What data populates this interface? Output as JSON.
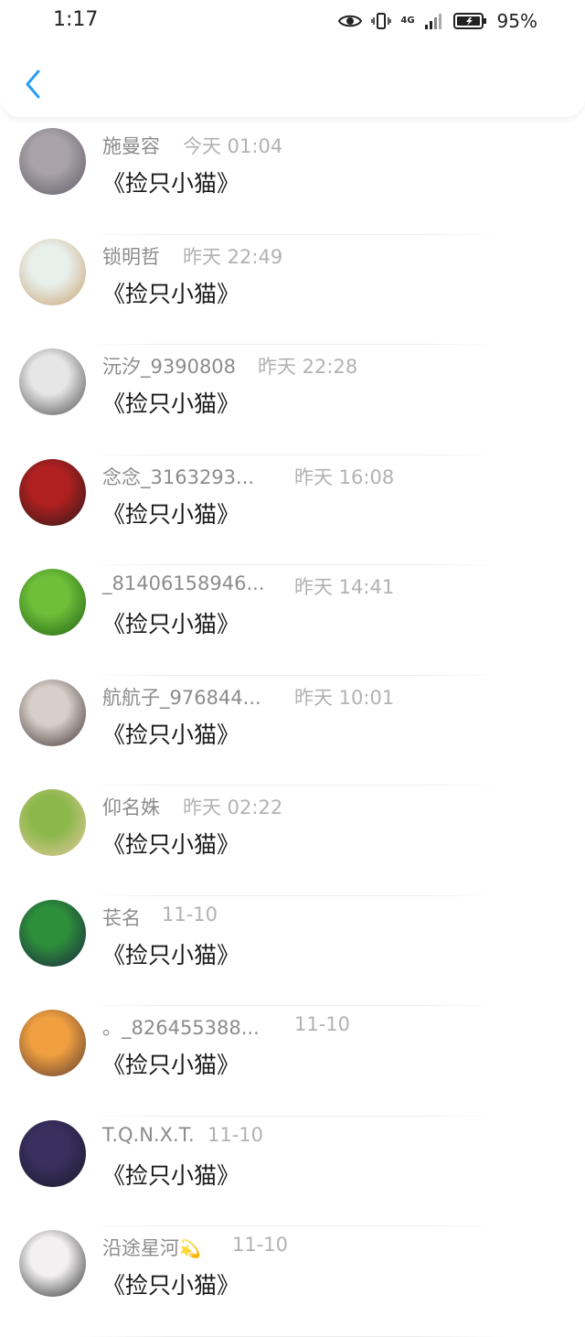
{
  "status_bar": {
    "time": "1:17",
    "network": "4G",
    "battery": "95%"
  },
  "header": {
    "back_icon": "chevron-left-icon"
  },
  "comments": [
    {
      "name": "施曼容",
      "time": "今天 01:04",
      "content": "《捡只小猫》",
      "avatar_colors": [
        "#a9a3a8",
        "#5d5a66"
      ]
    },
    {
      "name": "锁明哲",
      "time": "昨天 22:49",
      "content": "《捡只小猫》",
      "avatar_colors": [
        "#e8f0ec",
        "#c8a070"
      ]
    },
    {
      "name": "沅汐_9390808",
      "time": "昨天 22:28",
      "content": "《捡只小猫》",
      "avatar_colors": [
        "#e6e6e6",
        "#4a4a4a"
      ]
    },
    {
      "name": "念念_3163293...",
      "time": "昨天 16:08",
      "content": "《捡只小猫》",
      "avatar_colors": [
        "#b02020",
        "#2b1a18"
      ]
    },
    {
      "name": "_81406158946...",
      "time": "昨天 14:41",
      "content": "《捡只小猫》",
      "avatar_colors": [
        "#6fbf3a",
        "#1e5e12"
      ]
    },
    {
      "name": "航航子_976844...",
      "time": "昨天 10:01",
      "content": "《捡只小猫》",
      "avatar_colors": [
        "#d8cfc8",
        "#3a3030"
      ]
    },
    {
      "name": "仰名姝",
      "time": "昨天 02:22",
      "content": "《捡只小猫》",
      "avatar_colors": [
        "#8ab84a",
        "#e8c8a0"
      ]
    },
    {
      "name": "苌名",
      "time": "11-10",
      "content": "《捡只小猫》",
      "avatar_colors": [
        "#2d8f3a",
        "#1b2440"
      ]
    },
    {
      "name": "。_826455388...",
      "time": "11-10",
      "content": "《捡只小猫》",
      "avatar_colors": [
        "#f0a040",
        "#5a3a30"
      ]
    },
    {
      "name": "T.Q.N.X.T.",
      "time": "11-10",
      "content": "《捡只小猫》",
      "avatar_colors": [
        "#3a3060",
        "#181828"
      ]
    },
    {
      "name": "沿途星河",
      "time": "11-10",
      "content": "《捡只小猫》",
      "avatar_colors": [
        "#f2f0f0",
        "#2a2a2a"
      ],
      "emoji": "💫"
    }
  ]
}
